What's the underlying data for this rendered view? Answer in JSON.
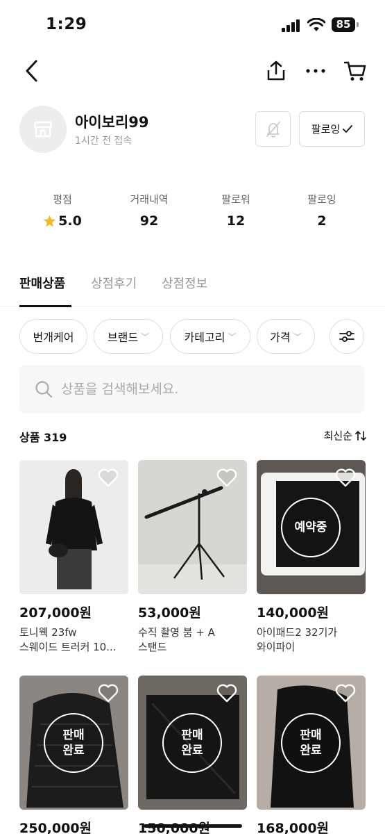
{
  "status_bar": {
    "time": "1:29",
    "battery": "85"
  },
  "shop": {
    "name": "아이보리99",
    "last_seen": "1시간 전 접속",
    "follow_label": "팔로잉"
  },
  "stats": [
    {
      "label": "평점",
      "value": "5.0"
    },
    {
      "label": "거래내역",
      "value": "92"
    },
    {
      "label": "팔로워",
      "value": "12"
    },
    {
      "label": "팔로잉",
      "value": "2"
    }
  ],
  "tabs": [
    {
      "label": "판매상품",
      "active": true
    },
    {
      "label": "상점후기",
      "active": false
    },
    {
      "label": "상점정보",
      "active": false
    }
  ],
  "filters": [
    {
      "label": "번개케어"
    },
    {
      "label": "브랜드"
    },
    {
      "label": "카테고리"
    },
    {
      "label": "가격"
    }
  ],
  "search": {
    "placeholder": "상품을 검색해보세요."
  },
  "products_header": {
    "label": "상품 319",
    "sort_label": "최신순"
  },
  "products": [
    {
      "price": "207,000원",
      "title_line1": "토니웩 23fw",
      "title_line2": "스웨이드 트러커 10...",
      "badge": ""
    },
    {
      "price": "53,000원",
      "title_line1": "수직 촬영 붐 + A",
      "title_line2": "스탠드",
      "badge": ""
    },
    {
      "price": "140,000원",
      "title_line1": "아이패드2 32기가",
      "title_line2": "와이파이",
      "badge": "예약중"
    },
    {
      "price": "250,000원",
      "title_line1": "",
      "title_line2": "",
      "badge": "판매\n완료"
    },
    {
      "price": "150,000원",
      "title_line1": "",
      "title_line2": "",
      "badge": "판매\n완료"
    },
    {
      "price": "168,000원",
      "title_line1": "",
      "title_line2": "",
      "badge": "판매\n완료"
    }
  ],
  "colors": {
    "star": "#f5b82e",
    "border": "#dddddd",
    "muted": "#999999"
  }
}
